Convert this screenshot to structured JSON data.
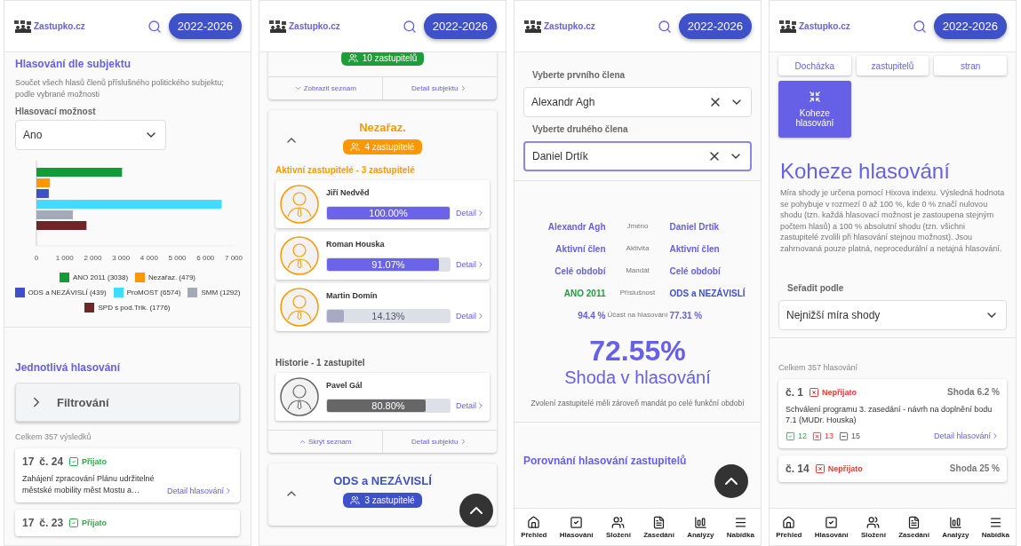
{
  "panels": [
    {
      "kind": "party_votes",
      "header": {
        "logo": "Zastupko.cz",
        "term": "2022-2026"
      },
      "title": "Hlasování dle subjektu",
      "description": "Součet všech hlasů členů příslušného politického subjektu; podle vybrané možnosti",
      "option_label": "Hlasovací možnost",
      "option_value": "Ano",
      "chart_data": {
        "type": "bar",
        "orientation": "horizontal",
        "series": [
          {
            "name": "ANO 2011 (3038)",
            "color": "#0f9d3a",
            "values": [
              3038
            ]
          },
          {
            "name": "Nezařaz. (479)",
            "color": "#ff9800",
            "values": [
              479
            ]
          },
          {
            "name": "ODS a NEZÁVISLÍ (439)",
            "color": "#3f51c8",
            "values": [
              439
            ]
          },
          {
            "name": "ProMOST (6574)",
            "color": "#40dcff",
            "values": [
              6574
            ]
          },
          {
            "name": "SMM (1292)",
            "color": "#a3aab8",
            "values": [
              1292
            ]
          },
          {
            "name": "SPD s pod.Trik. (1776)",
            "color": "#6e2727",
            "values": [
              1776
            ]
          }
        ],
        "xlim": [
          0,
          7000
        ],
        "xticks": [
          {
            "value": 0,
            "label": "0"
          },
          {
            "value": 1000,
            "label": "1 000"
          },
          {
            "value": 2000,
            "label": "2 000"
          },
          {
            "value": 3000,
            "label": "3 000"
          },
          {
            "value": 4000,
            "label": "4 000"
          },
          {
            "value": 5000,
            "label": "5 000"
          },
          {
            "value": 6000,
            "label": "6 000"
          },
          {
            "value": 7000,
            "label": "7 000"
          }
        ]
      },
      "votes_title": "Jednotlivá hlasování",
      "filter": {
        "label": "Filtrování",
        "expanded": false
      },
      "total": "Celkem 357 výsledků",
      "votes": [
        {
          "session": "17",
          "number": "č. 24",
          "status": "Přijato",
          "passed": true,
          "title": "Zahájení zpracování Plánu udržitelné městské mobility měst Mostu a…",
          "link": "Detail hlasování"
        },
        {
          "session": "17",
          "number": "č. 23",
          "status": "Přijato",
          "passed": true
        }
      ]
    },
    {
      "kind": "parties",
      "header": {
        "logo": "Zastupko.cz",
        "term": "2022-2026"
      },
      "top_card": {
        "badge": "10 zastupitelů",
        "color": "#1e9e3a",
        "expanded": false,
        "toggle": "Zobrazit seznam",
        "detail": "Detail subjektu"
      },
      "group": {
        "name": "Nezařaz.",
        "color": "#ff9800",
        "badge": "4 zastupitelé",
        "expanded": true,
        "active_title": "Aktivní zastupitelé - 3 zastupitelé",
        "members": [
          {
            "name": "Jiří Nedvěd",
            "level": 1.0,
            "reading": "100.00%",
            "link": "Detail"
          },
          {
            "name": "Roman Houska",
            "level": 0.9107,
            "reading": "91.07%",
            "link": "Detail"
          },
          {
            "name": "Martin Domín",
            "level": 0.1413,
            "reading": "14.13%",
            "link": "Detail"
          }
        ],
        "history_title": "Historie - 1 zastupitel",
        "history": [
          {
            "name": "Pavel Gál",
            "level": 0.808,
            "reading": "80.80%",
            "link": "Detail"
          }
        ],
        "toggle": "Skrýt seznam",
        "detail": "Detail subjektu"
      },
      "next_group": {
        "name": "ODS a NEZÁVISLÍ",
        "color": "#3f51c8",
        "badge": "3 zastupitelé",
        "expanded": true
      }
    },
    {
      "kind": "compare",
      "header": {
        "logo": "Zastupko.cz",
        "term": "2022-2026"
      },
      "fields": [
        {
          "label": "Vyberte prvního člena",
          "value": "Alexandr Agh",
          "focused": false
        },
        {
          "label": "Vyberte druhého člena",
          "value": "Daniel Drtík",
          "focused": true
        }
      ],
      "rows": [
        {
          "left": {
            "text": "Alexandr Agh"
          },
          "label": "Jméno",
          "right": {
            "text": "Daniel Drtík"
          }
        },
        {
          "left": {
            "text": "Aktivní člen"
          },
          "label": "Aktivita",
          "right": {
            "text": "Aktivní člen"
          }
        },
        {
          "left": {
            "text": "Celé období"
          },
          "label": "Mandát",
          "right": {
            "text": "Celé období"
          }
        },
        {
          "left": {
            "text": "ANO 2011",
            "color": "#1e9e3a"
          },
          "label": "Příslušnost",
          "right": {
            "text": "ODS a NEZÁVISLÍ",
            "color": "#3f51c8"
          }
        },
        {
          "left": {
            "text": "94.4 %"
          },
          "label": "Účast na hlasování",
          "right": {
            "text": "77.31 %"
          }
        }
      ],
      "match": "72.55%",
      "match_label": "Shoda v hlasování",
      "note": "Zvolení zastupitelé měli zároveň mandát po celé funkční období",
      "section": "Porovnání hlasování zastupitelů",
      "nav": [
        "Přehled",
        "Hlasování",
        "Složení",
        "Zasedání",
        "Analýzy",
        "Nabídka"
      ]
    },
    {
      "kind": "cohesion",
      "header": {
        "logo": "Zastupko.cz",
        "term": "2022-2026"
      },
      "tiles": [
        {
          "label": "Docházka",
          "selected": false
        },
        {
          "label": "zastupitelů",
          "selected": false
        },
        {
          "label": "stran",
          "selected": false
        },
        {
          "label": "Koheze hlasování",
          "selected": true
        }
      ],
      "title": "Koheze hlasování",
      "description": "Míra shody je určena pomocí Hixova indexu. Výsledná hodnota se pohybuje v rozmezí 0 až 100 %, kde 0 % značí nulovou shodu (tzn. každá hlasovací možnost je zastoupena stejným počtem hlasů) a 100 % absolutní shodu (tzn. všichni zastupitelé zvolili při hlasování stejnou možnost). Jsou zahrnovaná pouze platná, neprocedurální a netajná hlasování.",
      "sort_label": "Seřadit podle",
      "sort_value": "Nejnižší míra shody",
      "total": "Celkem 357 hlasování",
      "items": [
        {
          "number": "č. 1",
          "status": "Nepřijato",
          "passed": false,
          "agreement": "Shoda 6.2 %",
          "title": "Schválení programu 3. zasedání - návrh na doplnění bodu 7.1 (MUDr. Houska)",
          "yes": "12",
          "no": "13",
          "abstain": "15",
          "link": "Detail hlasování"
        },
        {
          "number": "č. 14",
          "status": "Nepřijato",
          "passed": false,
          "agreement": "Shoda 25 %"
        }
      ],
      "nav": [
        "Přehled",
        "Hlasování",
        "Složení",
        "Zasedání",
        "Analýzy",
        "Nabídka"
      ]
    }
  ]
}
